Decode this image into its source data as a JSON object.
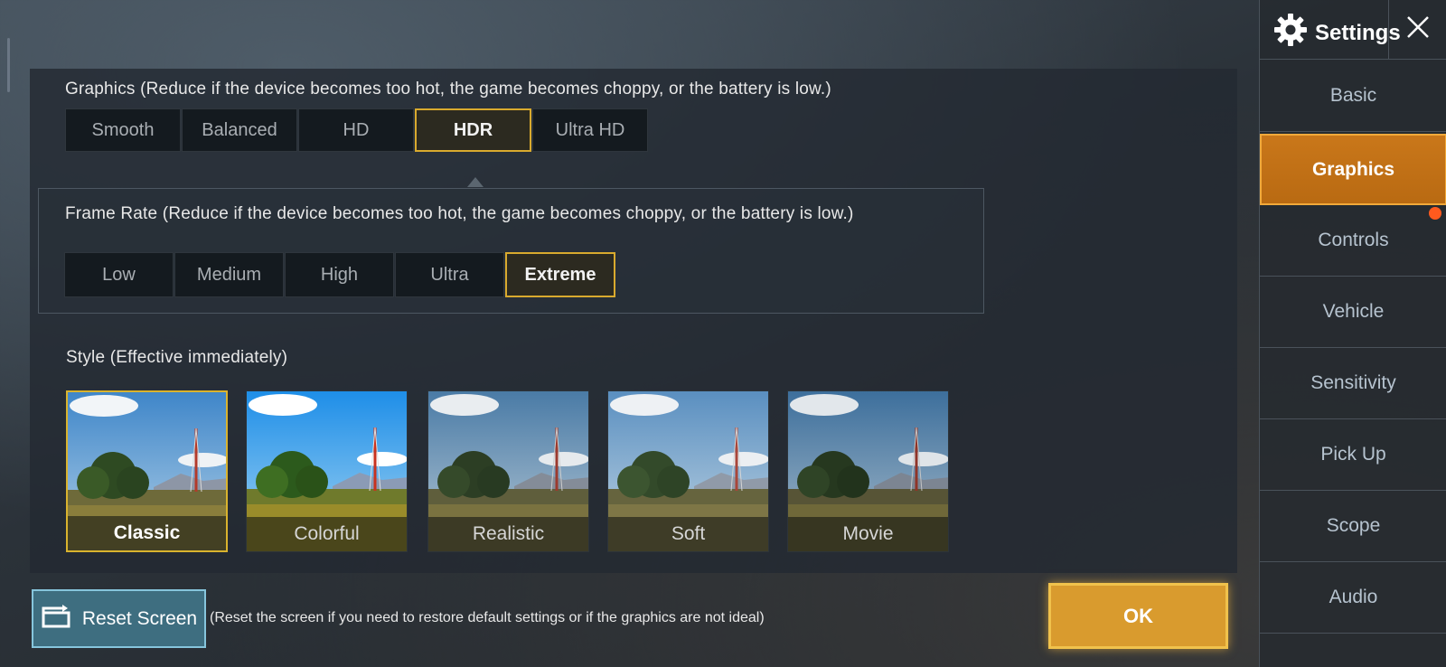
{
  "graphics": {
    "title": "Graphics (Reduce if the device becomes too hot, the game becomes choppy, or the battery is low.)",
    "options": [
      "Smooth",
      "Balanced",
      "HD",
      "HDR",
      "Ultra HD"
    ],
    "selected": "HDR"
  },
  "frame_rate": {
    "title": "Frame Rate (Reduce if the device becomes too hot, the game becomes choppy, or the battery is low.)",
    "options": [
      "Low",
      "Medium",
      "High",
      "Ultra",
      "Extreme"
    ],
    "selected": "Extreme"
  },
  "style": {
    "title": "Style (Effective immediately)",
    "options": [
      "Classic",
      "Colorful",
      "Realistic",
      "Soft",
      "Movie"
    ],
    "selected": "Classic"
  },
  "bottom": {
    "reset_label": "Reset Screen",
    "reset_hint": "(Reset the screen if you need to restore default settings or if the graphics are not ideal)",
    "ok_label": "OK"
  },
  "sidebar": {
    "title": "Settings",
    "items": [
      "Basic",
      "Graphics",
      "Controls",
      "Vehicle",
      "Sensitivity",
      "Pick Up",
      "Scope",
      "Audio"
    ],
    "active": "Graphics"
  },
  "colors": {
    "accent": "#d99b2e",
    "selected_border": "#d9aa2e",
    "notification": "#ff5a1e",
    "reset_button": "#3e6e80"
  },
  "icons": {
    "settings": "gear-icon",
    "close": "close-icon",
    "reset": "reset-screen-icon"
  }
}
